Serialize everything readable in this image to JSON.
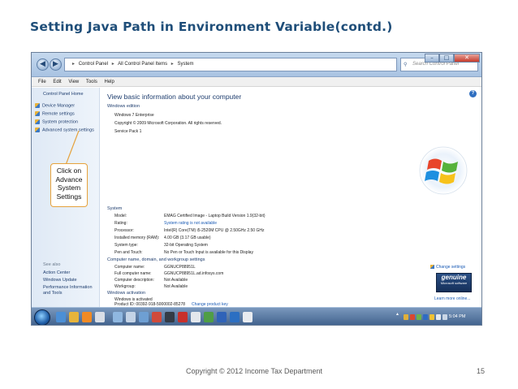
{
  "slide": {
    "title": "Setting Java Path in Environment Variable(contd.)",
    "footer": "Copyright © 2012 Income Tax Department",
    "page_number": "15",
    "callout": [
      "Click on",
      "Advance",
      "System",
      "Settings"
    ]
  },
  "window": {
    "nav_back": "◀",
    "nav_forward": "▶",
    "address": [
      "Control Panel",
      "All Control Panel Items",
      "System"
    ],
    "address_separator": "▸",
    "search_placeholder": "Search Control Panel",
    "search_icon": "⚲",
    "controls": {
      "minimize": "–",
      "maximize": "□",
      "close": "✕"
    }
  },
  "menubar": [
    "File",
    "Edit",
    "View",
    "Tools",
    "Help"
  ],
  "left_pane": {
    "home": "Control Panel Home",
    "items": [
      "Device Manager",
      "Remote settings",
      "System protection",
      "Advanced system settings"
    ],
    "see_also_heading": "See also",
    "see_also": [
      "Action Center",
      "Windows Update",
      "Performance Information and Tools"
    ]
  },
  "main": {
    "title": "View basic information about your computer",
    "help_icon": "?",
    "edition": {
      "heading": "Windows edition",
      "lines": [
        "Windows 7 Enterprise",
        "Copyright © 2009 Microsoft Corporation.  All rights reserved.",
        "Service Pack 1"
      ]
    },
    "system": {
      "heading": "System",
      "rows": [
        {
          "label": "Model:",
          "value": "EMAG Certified Image - Laptop Build Version 1.9(32-bit)"
        },
        {
          "label": "Rating:",
          "value": "System rating is not available"
        },
        {
          "label": "Processor:",
          "value": "Intel(R) Core(TM) i5-2520M CPU @ 2.50GHz  2.50 GHz"
        },
        {
          "label": "Installed memory (RAM):",
          "value": "4.00 GB (3.17 GB usable)"
        },
        {
          "label": "System type:",
          "value": "32-bit Operating System"
        },
        {
          "label": "Pen and Touch:",
          "value": "No Pen or Touch Input is available for this Display"
        }
      ]
    },
    "computer_name": {
      "heading": "Computer name, domain, and workgroup settings",
      "change_settings": "Change settings",
      "rows": [
        {
          "label": "Computer name:",
          "value": "GGNUCP88951L"
        },
        {
          "label": "Full computer name:",
          "value": "GGNUCP88951L.ad.infosys.com"
        },
        {
          "label": "Computer description:",
          "value": "Not Available"
        },
        {
          "label": "Workgroup:",
          "value": "Not Available"
        }
      ]
    },
    "activation": {
      "heading": "Windows activation",
      "status": "Windows is activated",
      "product_id_label": "Product ID: 00392-918-5000002-85278",
      "change_product_key": "Change product key",
      "genuine_line1": "genuine",
      "genuine_line2": "Microsoft software",
      "learn_more": "Learn more online..."
    }
  },
  "taskbar": {
    "clock": "5:04 PM",
    "tray": "▲"
  },
  "colors": {
    "title_blue": "#1f4e79",
    "link_blue": "#1a5bb5",
    "callout_border": "#e6a23c"
  }
}
